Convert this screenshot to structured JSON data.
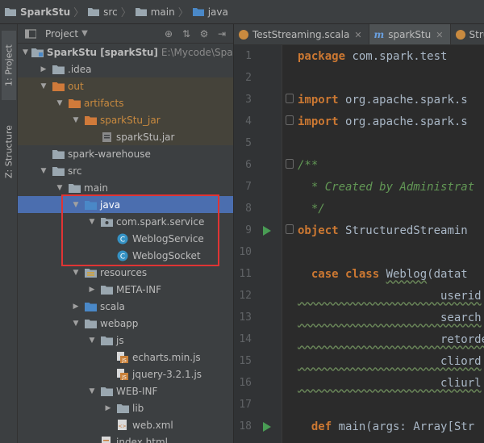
{
  "breadcrumb": [
    {
      "label": "SparkStu",
      "bold": true
    },
    {
      "label": "src"
    },
    {
      "label": "main"
    },
    {
      "label": "java"
    }
  ],
  "tool_strip": {
    "project_tab": "1: Project",
    "structure_tab": "Z: Structure"
  },
  "project_panel": {
    "title": "Project",
    "tools": [
      "target-icon",
      "collapse-icon",
      "settings-icon",
      "hide-icon"
    ],
    "tree": [
      {
        "label": "SparkStu [sparkStu]",
        "extra": "E:\\Mycode\\Spark",
        "depth": 0,
        "expanded": true,
        "icon": "module",
        "bold": true
      },
      {
        "label": ".idea",
        "depth": 1,
        "expanded": false,
        "icon": "folder"
      },
      {
        "label": "out",
        "depth": 1,
        "expanded": true,
        "icon": "folder-orange",
        "orange": true,
        "tinted": true
      },
      {
        "label": "artifacts",
        "depth": 2,
        "expanded": true,
        "icon": "folder-orange",
        "orange": true,
        "tinted": true
      },
      {
        "label": "sparkStu_jar",
        "depth": 3,
        "expanded": true,
        "icon": "folder-orange",
        "orange": true,
        "tinted": true
      },
      {
        "label": "sparkStu.jar",
        "depth": 4,
        "icon": "jar",
        "tinted": true
      },
      {
        "label": "spark-warehouse",
        "depth": 1,
        "icon": "folder"
      },
      {
        "label": "src",
        "depth": 1,
        "expanded": true,
        "icon": "folder"
      },
      {
        "label": "main",
        "depth": 2,
        "expanded": true,
        "icon": "folder"
      },
      {
        "label": "java",
        "depth": 3,
        "expanded": true,
        "icon": "folder-blue",
        "selected": true
      },
      {
        "label": "com.spark.service",
        "depth": 4,
        "expanded": true,
        "icon": "package"
      },
      {
        "label": "WeblogService",
        "depth": 5,
        "icon": "class"
      },
      {
        "label": "WeblogSocket",
        "depth": 5,
        "icon": "class"
      },
      {
        "label": "resources",
        "depth": 3,
        "expanded": true,
        "icon": "folder-res"
      },
      {
        "label": "META-INF",
        "depth": 4,
        "expanded": false,
        "icon": "folder"
      },
      {
        "label": "scala",
        "depth": 3,
        "expanded": false,
        "icon": "folder-blue"
      },
      {
        "label": "webapp",
        "depth": 3,
        "expanded": true,
        "icon": "folder"
      },
      {
        "label": "js",
        "depth": 4,
        "expanded": true,
        "icon": "folder"
      },
      {
        "label": "echarts.min.js",
        "depth": 5,
        "icon": "js"
      },
      {
        "label": "jquery-3.2.1.js",
        "depth": 5,
        "icon": "js"
      },
      {
        "label": "WEB-INF",
        "depth": 4,
        "expanded": true,
        "icon": "folder"
      },
      {
        "label": "lib",
        "depth": 5,
        "expanded": false,
        "icon": "folder"
      },
      {
        "label": "web.xml",
        "depth": 5,
        "icon": "xml"
      },
      {
        "label": "index.html",
        "depth": 4,
        "icon": "html"
      }
    ]
  },
  "editor": {
    "tabs": [
      {
        "label": "TestStreaming.scala",
        "icon": "scala",
        "active": false
      },
      {
        "label": "sparkStu",
        "icon": "m",
        "active": true
      },
      {
        "label": "Stru",
        "icon": "scala",
        "active": false
      }
    ],
    "lines": [
      {
        "n": "1",
        "tokens": [
          [
            "kw",
            "package "
          ],
          [
            "pk",
            "com.spark.test"
          ]
        ]
      },
      {
        "n": "2",
        "tokens": []
      },
      {
        "n": "3",
        "tokens": [
          [
            "kw",
            "import "
          ],
          [
            "pk",
            "org.apache.spark.s"
          ]
        ],
        "fold": true
      },
      {
        "n": "4",
        "tokens": [
          [
            "kw",
            "import "
          ],
          [
            "pk",
            "org.apache.spark.s"
          ]
        ],
        "fold": true
      },
      {
        "n": "5",
        "tokens": []
      },
      {
        "n": "6",
        "tokens": [
          [
            "cm",
            "/**"
          ]
        ],
        "fold": true
      },
      {
        "n": "7",
        "tokens": [
          [
            "cm",
            "  * Created by Administrat"
          ]
        ]
      },
      {
        "n": "8",
        "tokens": [
          [
            "cm",
            "  */"
          ]
        ]
      },
      {
        "n": "9",
        "tokens": [
          [
            "kw",
            "object "
          ],
          [
            "pk",
            "StructuredStreamin"
          ]
        ],
        "run": true,
        "fold": true
      },
      {
        "n": "10",
        "tokens": []
      },
      {
        "n": "11",
        "tokens": [
          [
            "kw",
            "  case class "
          ],
          [
            "wv",
            "Weblog"
          ],
          [
            "pk",
            "(datat"
          ]
        ]
      },
      {
        "n": "12",
        "tokens": [
          [
            "wv",
            "                     userid"
          ]
        ]
      },
      {
        "n": "13",
        "tokens": [
          [
            "wv",
            "                     search"
          ]
        ]
      },
      {
        "n": "14",
        "tokens": [
          [
            "wv",
            "                     retorde"
          ]
        ]
      },
      {
        "n": "15",
        "tokens": [
          [
            "wv",
            "                     cliord"
          ]
        ]
      },
      {
        "n": "16",
        "tokens": [
          [
            "wv",
            "                     cliurl"
          ]
        ]
      },
      {
        "n": "17",
        "tokens": []
      },
      {
        "n": "18",
        "tokens": [
          [
            "kw",
            "  def "
          ],
          [
            "pk",
            "main(args: Array[Str"
          ]
        ],
        "run": true
      },
      {
        "n": "19",
        "tokens": []
      }
    ]
  },
  "colors": {
    "selection": "#4b6eaf",
    "highlight_box": "#e03434",
    "keyword": "#cc7832",
    "comment": "#629755"
  }
}
